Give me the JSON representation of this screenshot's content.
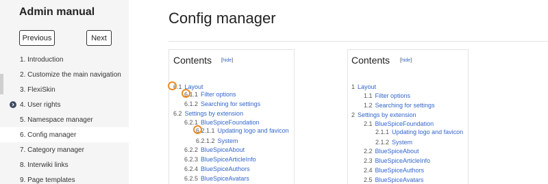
{
  "sidebar": {
    "title": "Admin manual",
    "prev_label": "Previous",
    "next_label": "Next",
    "items": [
      {
        "label": "1. Introduction"
      },
      {
        "label": "2. Customize the main navigation"
      },
      {
        "label": "3. FlexiSkin"
      },
      {
        "label": "4. User rights"
      },
      {
        "label": "5. Namespace manager"
      },
      {
        "label": "6. Config manager"
      },
      {
        "label": "7. Category manager"
      },
      {
        "label": "8. Interwiki links"
      },
      {
        "label": "9. Page templates"
      }
    ]
  },
  "main": {
    "title": "Config manager",
    "toc_left": {
      "heading": "Contents",
      "hide_open": "[",
      "hide_label": "hide",
      "hide_close": "]",
      "entries": [
        {
          "num": "6.1",
          "label": "Layout"
        },
        {
          "num": "6.1.1",
          "label": "Filter options"
        },
        {
          "num": "6.1.2",
          "label": "Searching for settings"
        },
        {
          "num": "6.2",
          "label": "Settings by extension"
        },
        {
          "num": "6.2.1",
          "label": "BlueSpiceFoundation"
        },
        {
          "num": "6.2.1.1",
          "label": "Updating logo and favicon"
        },
        {
          "num": "6.2.1.2",
          "label": "System"
        },
        {
          "num": "6.2.2",
          "label": "BlueSpiceAbout"
        },
        {
          "num": "6.2.3",
          "label": "BlueSpiceArticleInfo"
        },
        {
          "num": "6.2.4",
          "label": "BlueSpiceAuthors"
        },
        {
          "num": "6.2.5",
          "label": "BlueSpiceAvatars"
        }
      ]
    },
    "toc_right": {
      "heading": "Contents",
      "hide_open": "[",
      "hide_label": "hide",
      "hide_close": "]",
      "entries": [
        {
          "num": "1",
          "label": "Layout"
        },
        {
          "num": "1.1",
          "label": "Filter options"
        },
        {
          "num": "1.2",
          "label": "Searching for settings"
        },
        {
          "num": "2",
          "label": "Settings by extension"
        },
        {
          "num": "2.1",
          "label": "BlueSpiceFoundation"
        },
        {
          "num": "2.1.1",
          "label": "Updating logo and favicon"
        },
        {
          "num": "2.1.2",
          "label": "System"
        },
        {
          "num": "2.2",
          "label": "BlueSpiceAbout"
        },
        {
          "num": "2.3",
          "label": "BlueSpiceArticleInfo"
        },
        {
          "num": "2.4",
          "label": "BlueSpiceAuthors"
        },
        {
          "num": "2.5",
          "label": "BlueSpiceAvatars"
        }
      ]
    }
  },
  "colors": {
    "link": "#3366cc",
    "highlight": "#f08a24",
    "sidebar_bg": "#f5f5f5"
  },
  "icons": {
    "bullet": "chevron-right-icon"
  }
}
